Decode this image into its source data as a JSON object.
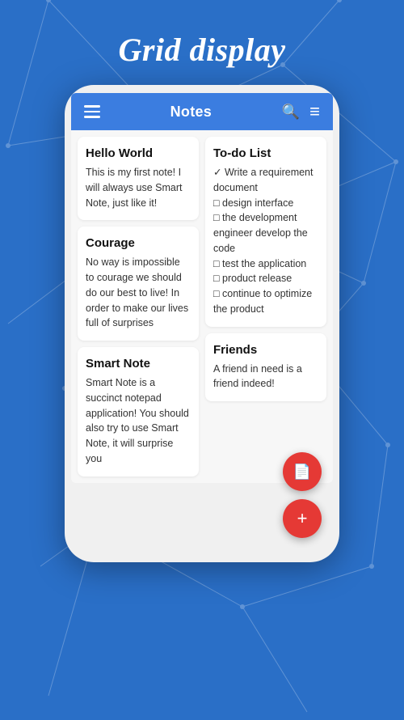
{
  "page": {
    "title": "Grid display",
    "background_color": "#2a6fc7"
  },
  "app_bar": {
    "title": "Notes",
    "search_icon": "🔍",
    "filter_icon": "≡",
    "menu_icon": "☰"
  },
  "notes": [
    {
      "id": "hello-world",
      "title": "Hello World",
      "body": "This is my first note! I will always use Smart Note, just like it!"
    },
    {
      "id": "to-do-list",
      "title": "To-do List",
      "body": "✓ Write a requirement document\n□ design interface\n□ the development engineer develop the code\n□ test the application\n□ product release\n□ continue to optimize the product"
    },
    {
      "id": "courage",
      "title": "Courage",
      "body": "No way is impossible to courage\nwe should do our best to live!\nIn order to make our lives full of surprises"
    },
    {
      "id": "friends",
      "title": "Friends",
      "body": "A friend in need is a friend indeed!"
    },
    {
      "id": "smart-note",
      "title": "Smart Note",
      "body": "Smart Note is a succinct notepad application!\nYou should also try to use Smart Note, it will surprise you"
    }
  ],
  "fab": {
    "doc_icon": "📄",
    "add_icon": "+"
  }
}
